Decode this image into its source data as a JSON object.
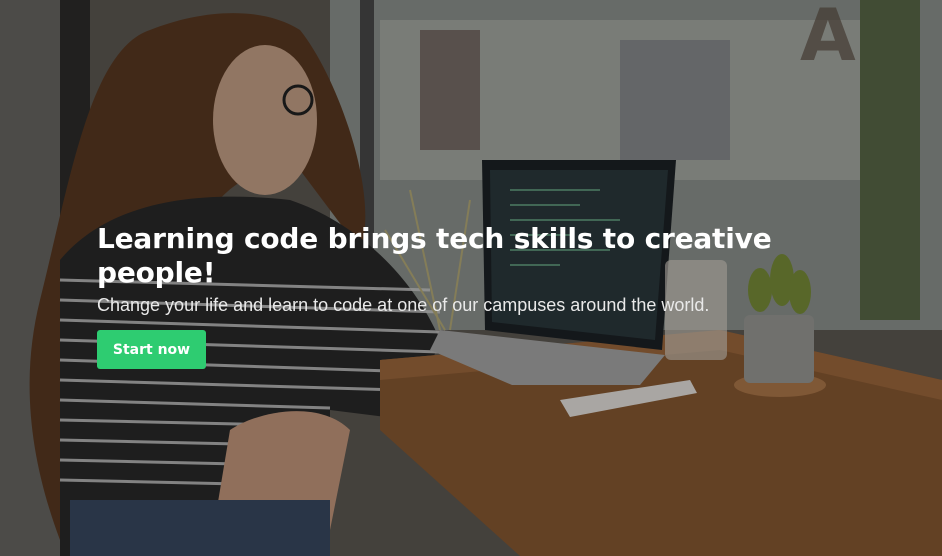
{
  "hero": {
    "headline": "Learning code brings tech skills to creative people!",
    "subtitle": "Change your life and learn to code at one of our campuses around the world.",
    "cta_label": "Start now",
    "cta_color": "#2ecc71",
    "background_image": "photo of woman with laptop at a cafe table"
  }
}
